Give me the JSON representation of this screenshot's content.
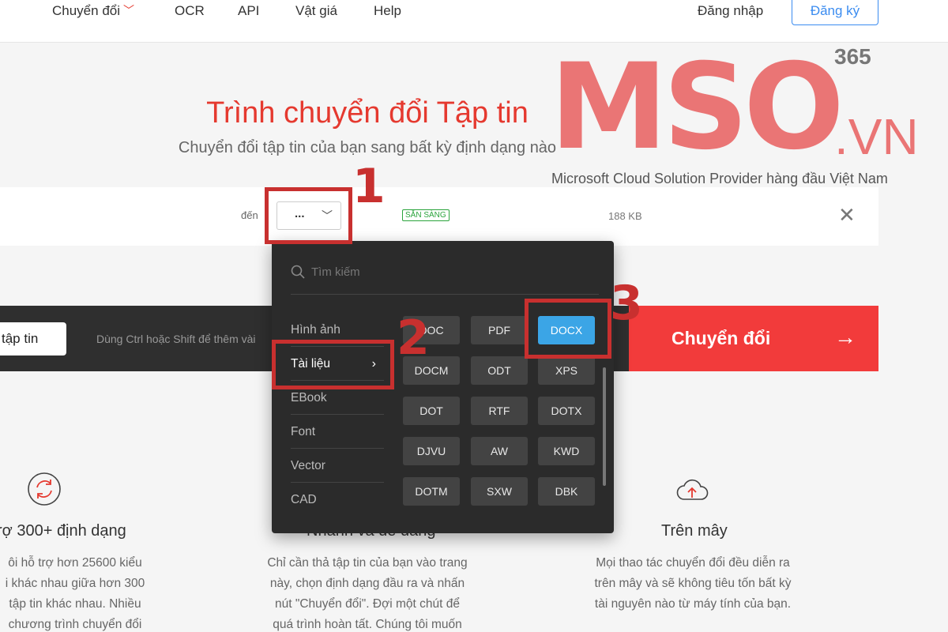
{
  "nav": {
    "items": [
      "Chuyển đổi",
      "OCR",
      "API",
      "Vật giá",
      "Help"
    ],
    "login": "Đăng nhập",
    "signup": "Đăng ký"
  },
  "hero": {
    "title": "Trình chuyển đổi Tập tin",
    "subtitle": "Chuyển đổi tập tin của bạn sang bất kỳ định dạng nào"
  },
  "watermark": {
    "brand": "MSO",
    "superscript": "365",
    "domain": ".VN",
    "tagline": "Microsoft Cloud Solution Provider hàng đầu Việt Nam"
  },
  "file_row": {
    "to_label": "đến",
    "format_value": "...",
    "status": "SẴN SÀNG",
    "size": "188 KB"
  },
  "action_bar": {
    "add_files": "tập tin",
    "hint": "Dùng Ctrl hoặc Shift để thêm vài",
    "convert": "Chuyển đổi"
  },
  "dropdown": {
    "search_placeholder": "Tìm kiếm",
    "categories": [
      "Hình ảnh",
      "Tài liệu",
      "EBook",
      "Font",
      "Vector",
      "CAD"
    ],
    "active_category": "Tài liệu",
    "formats": [
      "DOC",
      "PDF",
      "DOCX",
      "DOCM",
      "ODT",
      "XPS",
      "DOT",
      "RTF",
      "DOTX",
      "DJVU",
      "AW",
      "KWD",
      "DOTM",
      "SXW",
      "DBK"
    ],
    "selected_format": "DOCX",
    "selected_color": "#3ba5e6"
  },
  "features": [
    {
      "icon": "refresh-icon",
      "title": "rợ 300+ định dạng",
      "lines": [
        "ôi hỗ trợ hơn 25600 kiểu",
        "i khác nhau giữa hơn 300",
        "tập tin khác nhau. Nhiều",
        "chương trình chuyển đổi"
      ]
    },
    {
      "icon": "lightning-icon",
      "title": "Nhanh và dễ dàng",
      "lines": [
        "Chỉ cần thả tập tin của bạn vào trang",
        "này, chọn định dạng đầu ra và nhấn",
        "nút \"Chuyển đổi\". Đợi một chút để",
        "quá trình hoàn tất. Chúng tôi muốn"
      ]
    },
    {
      "icon": "cloud-upload-icon",
      "title": "Trên mây",
      "lines": [
        "Mọi thao tác chuyển đổi đều diễn ra",
        "trên mây và sẽ không tiêu tốn bất kỳ",
        "tài nguyên nào từ máy tính của bạn."
      ]
    }
  ],
  "annotations": [
    "1",
    "2",
    "3"
  ],
  "colors": {
    "accent": "#e5392f",
    "annotation": "#c8302f",
    "convert": "#f23b3b"
  }
}
